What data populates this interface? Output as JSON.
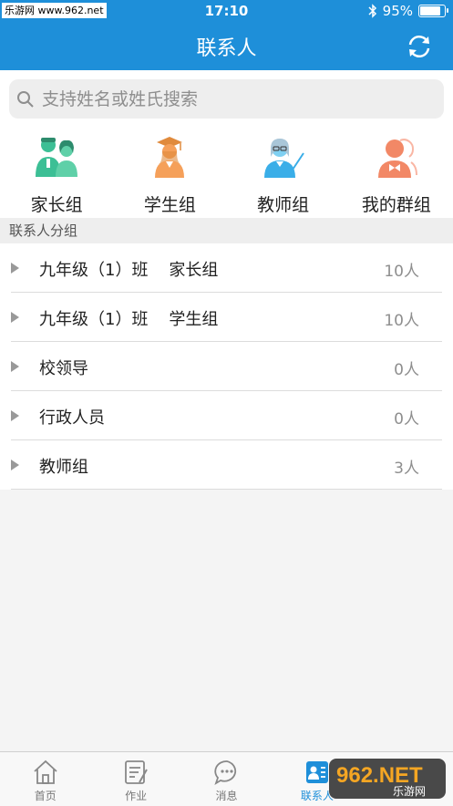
{
  "status_bar": {
    "site": "乐游网 www.962.net",
    "time": "17:10",
    "battery": "95%"
  },
  "nav": {
    "title": "联系人"
  },
  "search": {
    "placeholder": "支持姓名或姓氏搜索"
  },
  "groups": [
    {
      "label": "家长组",
      "icon": "parents-icon"
    },
    {
      "label": "学生组",
      "icon": "student-graduate-icon"
    },
    {
      "label": "教师组",
      "icon": "teacher-icon"
    },
    {
      "label": "我的群组",
      "icon": "my-group-icon"
    }
  ],
  "section": {
    "title": "联系人分组"
  },
  "contact_groups": [
    {
      "name": "九年级（1）班    家长组",
      "count": "10人"
    },
    {
      "name": "九年级（1）班    学生组",
      "count": "10人"
    },
    {
      "name": "校领导",
      "count": "0人"
    },
    {
      "name": "行政人员",
      "count": "0人"
    },
    {
      "name": "教师组",
      "count": "3人"
    }
  ],
  "tabs": [
    {
      "label": "首页",
      "icon": "home-icon",
      "active": false
    },
    {
      "label": "作业",
      "icon": "homework-icon",
      "active": false
    },
    {
      "label": "消息",
      "icon": "message-icon",
      "active": false
    },
    {
      "label": "联系人",
      "icon": "contacts-icon",
      "active": true
    }
  ],
  "watermark": {
    "brand": "962.NET",
    "subtitle": "乐游网"
  },
  "colors": {
    "primary": "#1e8fd9",
    "parents": "#3cbf95",
    "student": "#f5a05a",
    "teacher": "#3aaee8",
    "group": "#f28866"
  }
}
